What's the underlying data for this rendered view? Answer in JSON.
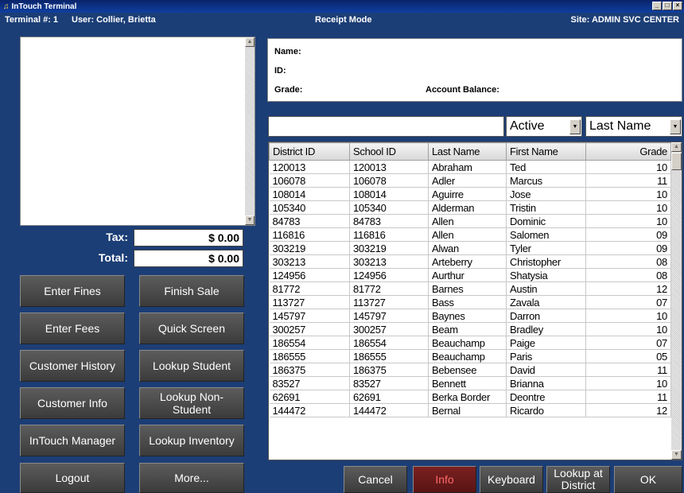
{
  "window": {
    "title": "InTouch Terminal"
  },
  "infobar": {
    "terminal": "Terminal #: 1",
    "user": "User: Collier, Brietta",
    "mode": "Receipt Mode",
    "site": "Site: ADMIN SVC CENTER"
  },
  "totals": {
    "tax_label": "Tax:",
    "tax_value": "$ 0.00",
    "total_label": "Total:",
    "total_value": "$ 0.00"
  },
  "left_buttons": {
    "enter_fines": "Enter Fines",
    "finish_sale": "Finish Sale",
    "enter_fees": "Enter Fees",
    "quick_screen": "Quick Screen",
    "customer_history": "Customer History",
    "lookup_student": "Lookup Student",
    "customer_info": "Customer Info",
    "lookup_non_student": "Lookup Non-Student",
    "intouch_manager": "InTouch Manager",
    "lookup_inventory": "Lookup Inventory",
    "logout": "Logout",
    "more": "More..."
  },
  "customer": {
    "name_label": "Name:",
    "id_label": "ID:",
    "grade_label": "Grade:",
    "balance_label": "Account Balance:"
  },
  "search": {
    "value": "",
    "status_filter": "Active",
    "sort_field": "Last Name"
  },
  "grid": {
    "columns": [
      "District ID",
      "School ID",
      "Last Name",
      "First Name",
      "Grade"
    ],
    "rows": [
      [
        "120013",
        "120013",
        "Abraham",
        "Ted",
        "10"
      ],
      [
        "106078",
        "106078",
        "Adler",
        "Marcus",
        "11"
      ],
      [
        "108014",
        "108014",
        "Aguirre",
        "Jose",
        "10"
      ],
      [
        "105340",
        "105340",
        "Alderman",
        "Tristin",
        "10"
      ],
      [
        "84783",
        "84783",
        "Allen",
        "Dominic",
        "10"
      ],
      [
        "116816",
        "116816",
        "Allen",
        "Salomen",
        "09"
      ],
      [
        "303219",
        "303219",
        "Alwan",
        "Tyler",
        "09"
      ],
      [
        "303213",
        "303213",
        "Arteberry",
        "Christopher",
        "08"
      ],
      [
        "124956",
        "124956",
        "Aurthur",
        "Shatysia",
        "08"
      ],
      [
        "81772",
        "81772",
        "Barnes",
        "Austin",
        "12"
      ],
      [
        "113727",
        "113727",
        "Bass",
        "Zavala",
        "07"
      ],
      [
        "145797",
        "145797",
        "Baynes",
        "Darron",
        "10"
      ],
      [
        "300257",
        "300257",
        "Beam",
        "Bradley",
        "10"
      ],
      [
        "186554",
        "186554",
        "Beauchamp",
        "Paige",
        "07"
      ],
      [
        "186555",
        "186555",
        "Beauchamp",
        "Paris",
        "05"
      ],
      [
        "186375",
        "186375",
        "Bebensee",
        "David",
        "11"
      ],
      [
        "83527",
        "83527",
        "Bennett",
        "Brianna",
        "10"
      ],
      [
        "62691",
        "62691",
        "Berka Border",
        "Deontre",
        "11"
      ],
      [
        "144472",
        "144472",
        "Bernal",
        "Ricardo",
        "12"
      ]
    ]
  },
  "bottom_buttons": {
    "cancel": "Cancel",
    "info": "Info",
    "keyboard": "Keyboard",
    "lookup_district": "Lookup at District",
    "ok": "OK"
  }
}
